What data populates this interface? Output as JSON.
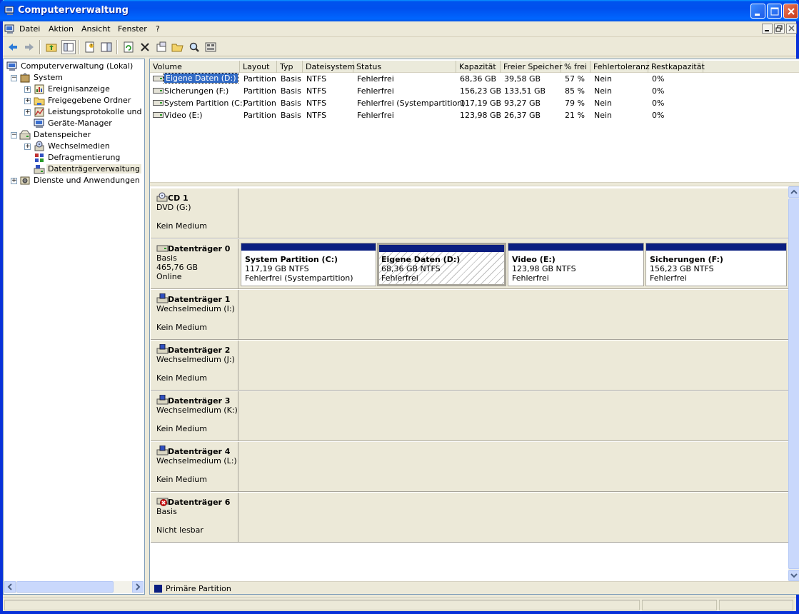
{
  "window": {
    "title": "Computerverwaltung"
  },
  "menu": {
    "items": [
      "Datei",
      "Aktion",
      "Ansicht",
      "Fenster",
      "?"
    ]
  },
  "tree": {
    "items": [
      {
        "label": "Computerverwaltung (Lokal)",
        "icon": "computer-icon"
      },
      {
        "label": "System",
        "icon": "system-tools-icon"
      },
      {
        "label": "Ereignisanzeige",
        "icon": "event-viewer-icon"
      },
      {
        "label": "Freigegebene Ordner",
        "icon": "shared-folders-icon"
      },
      {
        "label": "Leistungsprotokolle und War",
        "icon": "performance-logs-icon"
      },
      {
        "label": "Geräte-Manager",
        "icon": "device-manager-icon"
      },
      {
        "label": "Datenspeicher",
        "icon": "storage-icon"
      },
      {
        "label": "Wechselmedien",
        "icon": "removable-storage-icon"
      },
      {
        "label": "Defragmentierung",
        "icon": "defrag-icon"
      },
      {
        "label": "Datenträgerverwaltung",
        "icon": "disk-management-icon"
      },
      {
        "label": "Dienste und Anwendungen",
        "icon": "services-icon"
      }
    ]
  },
  "volumes": {
    "columns": [
      "Volume",
      "Layout",
      "Typ",
      "Dateisystem",
      "Status",
      "Kapazität",
      "Freier Speicher",
      "% frei",
      "Fehlertoleranz",
      "Restkapazität"
    ],
    "rows": [
      [
        "Eigene Daten (D:)",
        "Partition",
        "Basis",
        "NTFS",
        "Fehlerfrei",
        "68,36 GB",
        "39,58 GB",
        "57 %",
        "Nein",
        "0%"
      ],
      [
        "Sicherungen (F:)",
        "Partition",
        "Basis",
        "NTFS",
        "Fehlerfrei",
        "156,23 GB",
        "133,51 GB",
        "85 %",
        "Nein",
        "0%"
      ],
      [
        "System Partition (C:)",
        "Partition",
        "Basis",
        "NTFS",
        "Fehlerfrei (Systempartition)",
        "117,19 GB",
        "93,27 GB",
        "79 %",
        "Nein",
        "0%"
      ],
      [
        "Video (E:)",
        "Partition",
        "Basis",
        "NTFS",
        "Fehlerfrei",
        "123,98 GB",
        "26,37 GB",
        "21 %",
        "Nein",
        "0%"
      ]
    ]
  },
  "disks": [
    {
      "name": "CD 1",
      "line2": "DVD (G:)",
      "line3": "",
      "line4": "Kein Medium",
      "icon": "cd-drive-icon"
    },
    {
      "name": "Datenträger 0",
      "line2": "Basis",
      "line3": "465,76 GB",
      "line4": "Online",
      "icon": "hard-disk-icon",
      "partitions": [
        {
          "name": "System Partition  (C:)",
          "size": "117,19 GB NTFS",
          "status": "Fehlerfrei (Systempartition)"
        },
        {
          "name": "Eigene Daten  (D:)",
          "size": "68,36 GB NTFS",
          "status": "Fehlerfrei"
        },
        {
          "name": "Video  (E:)",
          "size": "123,98 GB NTFS",
          "status": "Fehlerfrei"
        },
        {
          "name": "Sicherungen  (F:)",
          "size": "156,23 GB NTFS",
          "status": "Fehlerfrei"
        }
      ]
    },
    {
      "name": "Datenträger 1",
      "line2": "Wechselmedium (I:)",
      "line3": "",
      "line4": "Kein Medium",
      "icon": "removable-disk-icon"
    },
    {
      "name": "Datenträger 2",
      "line2": "Wechselmedium (J:)",
      "line3": "",
      "line4": "Kein Medium",
      "icon": "removable-disk-icon"
    },
    {
      "name": "Datenträger 3",
      "line2": "Wechselmedium (K:)",
      "line3": "",
      "line4": "Kein Medium",
      "icon": "removable-disk-icon"
    },
    {
      "name": "Datenträger 4",
      "line2": "Wechselmedium (L:)",
      "line3": "",
      "line4": "Kein Medium",
      "icon": "removable-disk-icon"
    },
    {
      "name": "Datenträger 6",
      "line2": "Basis",
      "line3": "",
      "line4": "Nicht lesbar",
      "icon": "disk-error-icon"
    }
  ],
  "legend": {
    "label": "Primäre Partition",
    "color": "#0a1e80"
  },
  "colors": {
    "titlebar": "#0054e3",
    "partition_bar": "#0a1e80",
    "selection": "#316ac5"
  }
}
